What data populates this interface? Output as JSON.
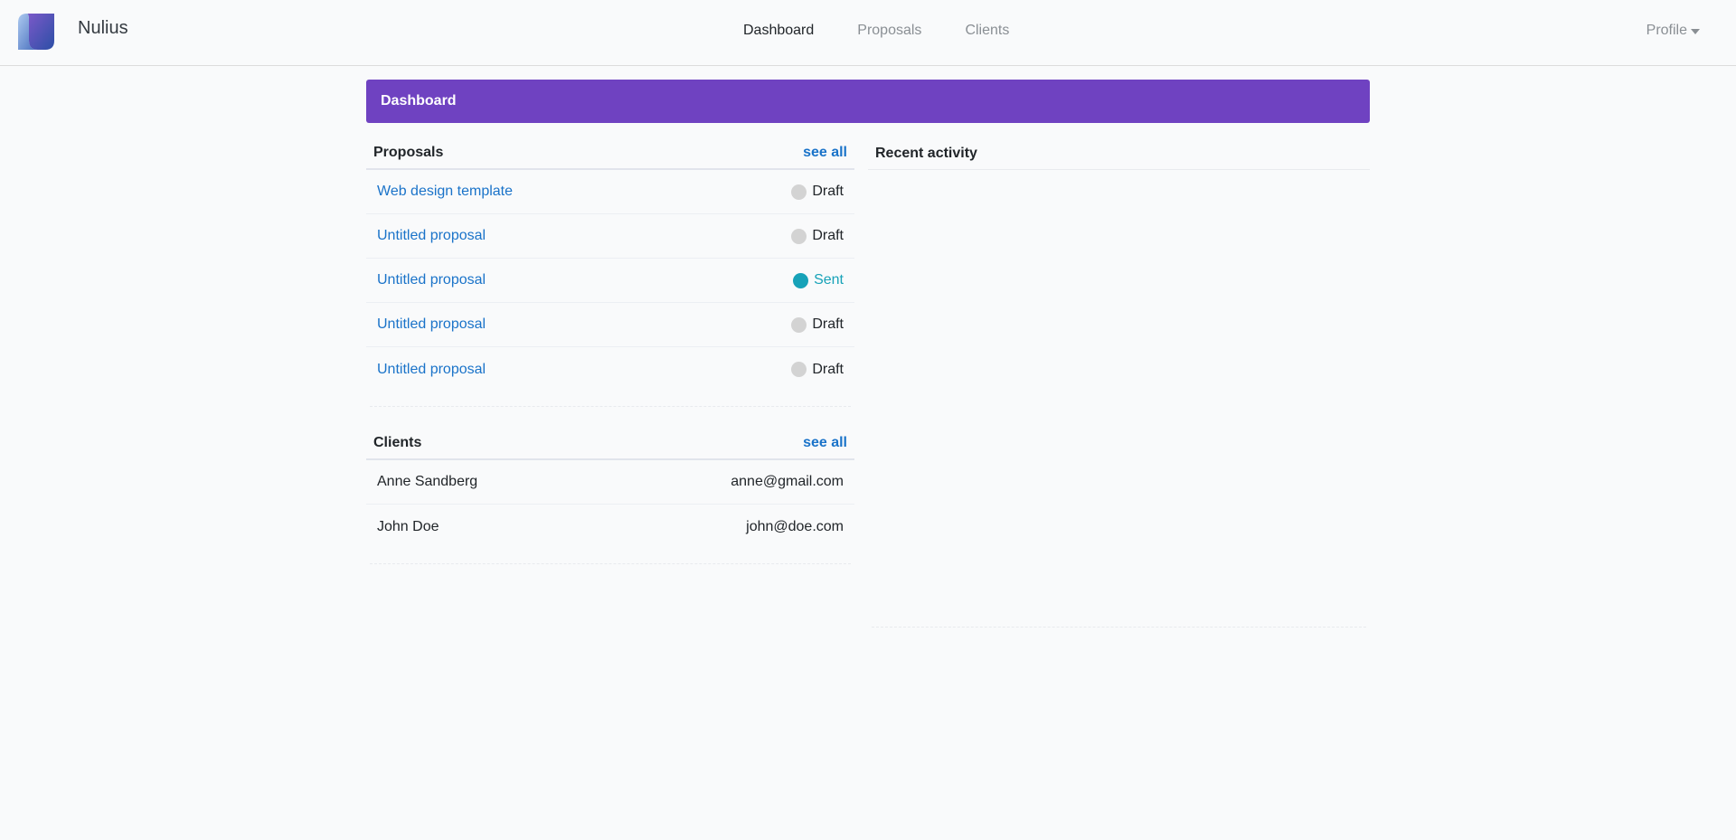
{
  "app": {
    "name": "Nulius"
  },
  "nav": {
    "links": [
      "Dashboard",
      "Proposals",
      "Clients"
    ],
    "profile": "Profile"
  },
  "banner": {
    "title": "Dashboard"
  },
  "proposals": {
    "title": "Proposals",
    "see_all": "see all",
    "items": [
      {
        "name": "Web design template",
        "status": "Draft",
        "status_color": "#d3d3d3"
      },
      {
        "name": "Untitled proposal",
        "status": "Draft",
        "status_color": "#d3d3d3"
      },
      {
        "name": "Untitled proposal",
        "status": "Sent",
        "status_color": "#17a2b8"
      },
      {
        "name": "Untitled proposal",
        "status": "Draft",
        "status_color": "#d3d3d3"
      },
      {
        "name": "Untitled proposal",
        "status": "Draft",
        "status_color": "#d3d3d3"
      }
    ]
  },
  "clients": {
    "title": "Clients",
    "see_all": "see all",
    "items": [
      {
        "name": "Anne Sandberg",
        "email": "anne@gmail.com"
      },
      {
        "name": "John Doe",
        "email": "john@doe.com"
      }
    ]
  },
  "activity": {
    "title": "Recent activity"
  },
  "colors": {
    "accent": "#6f42c1",
    "link": "#1a73c9",
    "sent": "#17a2b8",
    "draft": "#d3d3d3"
  }
}
